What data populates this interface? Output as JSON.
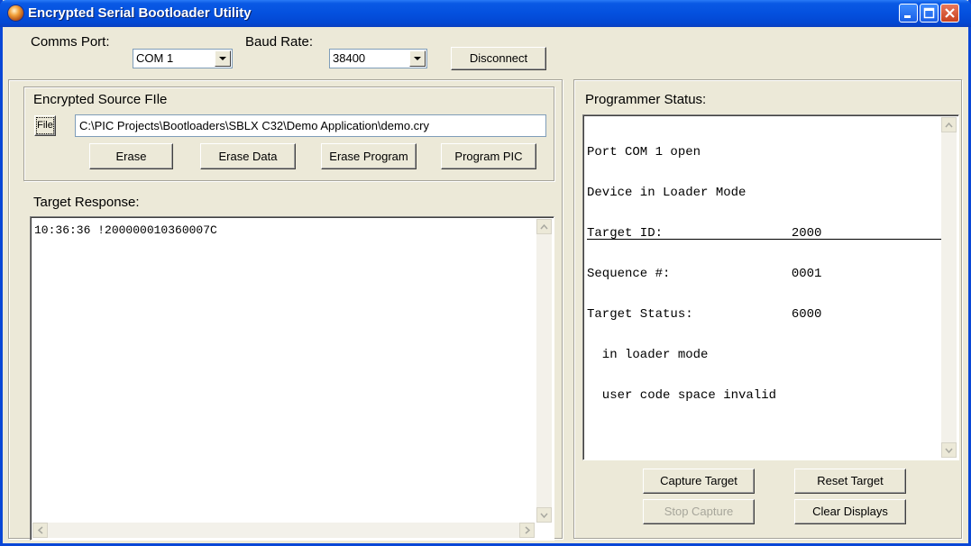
{
  "window": {
    "title": "Encrypted Serial Bootloader Utility"
  },
  "top_bar": {
    "comms_port_label": "Comms Port:",
    "comms_port_value": "COM 1",
    "baud_rate_label": "Baud Rate:",
    "baud_rate_value": "38400",
    "disconnect_label": "Disconnect"
  },
  "source_file": {
    "group_label": "Encrypted Source FIle",
    "file_button_label": "File",
    "path": "C:\\PIC Projects\\Bootloaders\\SBLX C32\\Demo Application\\demo.cry",
    "erase_label": "Erase",
    "erase_data_label": "Erase Data",
    "erase_program_label": "Erase Program",
    "program_pic_label": "Program PIC"
  },
  "target_response": {
    "label": "Target Response:",
    "lines": [
      "10:36:36 !200000010360007C"
    ]
  },
  "programmer_status": {
    "label": "Programmer Status:",
    "lines": [
      "Port COM 1 open",
      "Device in Loader Mode",
      "Target ID:                 2000",
      "Sequence #:                0001",
      "Target Status:             6000",
      "  in loader mode",
      "  user code space invalid"
    ]
  },
  "actions": {
    "capture_target_label": "Capture Target",
    "reset_target_label": "Reset Target",
    "stop_capture_label": "Stop Capture",
    "clear_displays_label": "Clear Displays"
  },
  "icons": [
    "app-icon",
    "minimize-icon",
    "maximize-icon",
    "close-icon",
    "dropdown-arrow-icon",
    "scroll-up-icon",
    "scroll-down-icon",
    "scroll-left-icon",
    "scroll-right-icon"
  ],
  "colors": {
    "titlebar": "#0450de",
    "face": "#ece9d8",
    "close_button": "#c8421f",
    "disabled_text": "#a7a69b"
  }
}
